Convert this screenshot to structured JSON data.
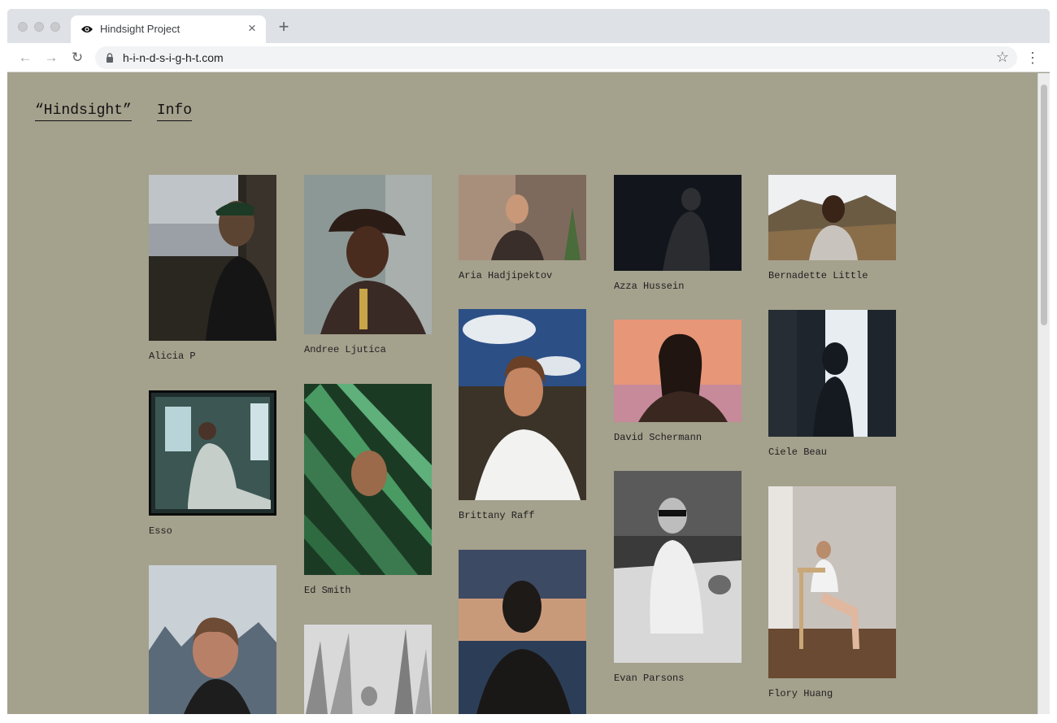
{
  "browser": {
    "tab_title": "Hindsight Project",
    "tab_close": "×",
    "new_tab": "+",
    "url": "h-i-n-d-s-i-g-h-t.com",
    "back": "←",
    "forward": "→",
    "reload": "↻",
    "bookmark": "☆",
    "menu": "⋮"
  },
  "nav": {
    "hindsight": "“Hindsight”",
    "info": "Info"
  },
  "gallery": [
    {
      "name": "Alicia P",
      "icon": "portrait-photo"
    },
    {
      "name": "Esso",
      "icon": "portrait-photo"
    },
    {
      "name": "Andree Ljutica",
      "icon": "portrait-photo"
    },
    {
      "name": "Ed Smith",
      "icon": "portrait-photo"
    },
    {
      "name": "Aria Hadjipektov",
      "icon": "portrait-photo"
    },
    {
      "name": "Brittany Raff",
      "icon": "portrait-photo"
    },
    {
      "name": "Azza Hussein",
      "icon": "portrait-photo"
    },
    {
      "name": "David Schermann",
      "icon": "portrait-photo"
    },
    {
      "name": "Evan Parsons",
      "icon": "portrait-photo"
    },
    {
      "name": "Bernadette Little",
      "icon": "portrait-photo"
    },
    {
      "name": "Ciele Beau",
      "icon": "portrait-photo"
    },
    {
      "name": "Flory Huang",
      "icon": "portrait-photo"
    }
  ],
  "colors": {
    "page_background": "#a4a18d",
    "text": "#111111"
  }
}
